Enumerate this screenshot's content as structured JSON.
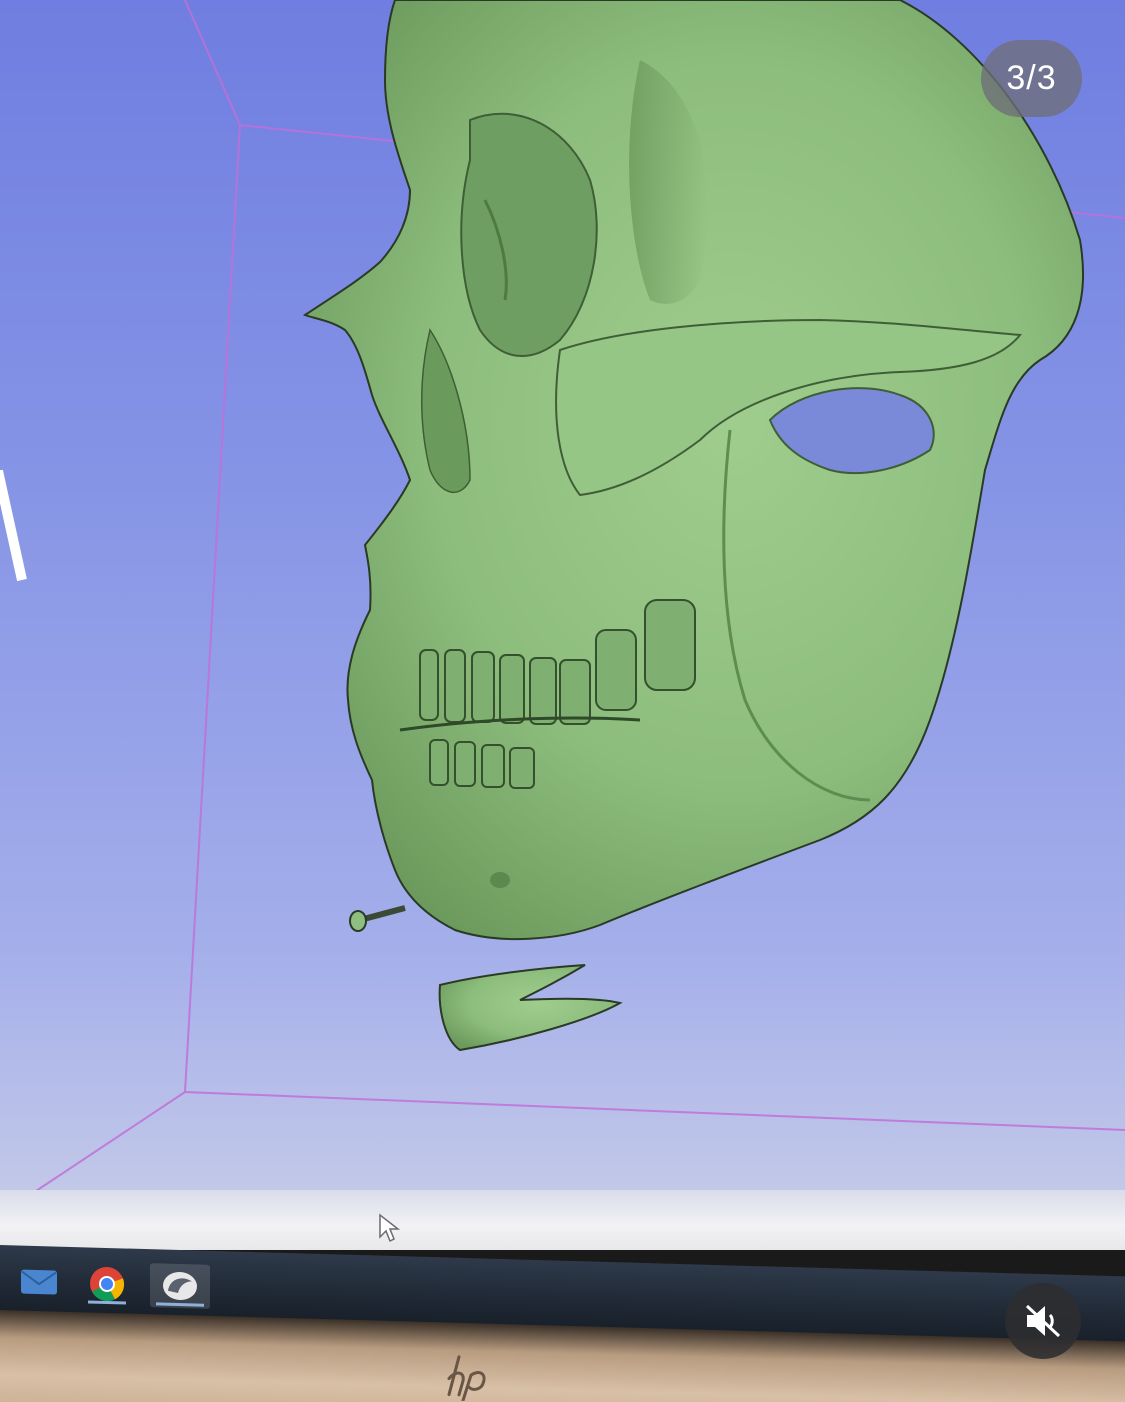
{
  "slideshow": {
    "counter": "3/3"
  },
  "icons": {
    "mute": "speaker-muted-icon",
    "brand": "hp-logo-icon",
    "taskbar": [
      "mail-icon",
      "chrome-icon",
      "3d-viewer-app-icon"
    ]
  },
  "colors": {
    "viewport_top": "#6f7ee0",
    "viewport_bottom": "#c9cee8",
    "model": "#8fbf80",
    "model_shadow": "#5d8a50",
    "bounding_box": "#c070d8",
    "taskbar": "#1e2733"
  }
}
